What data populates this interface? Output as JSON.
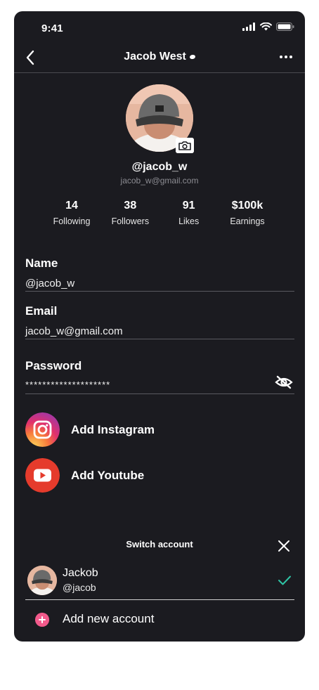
{
  "status": {
    "time": "9:41"
  },
  "nav": {
    "title": "Jacob West",
    "back_icon": "chevron-left-icon",
    "more_icon": "more-horizontal-icon"
  },
  "profile": {
    "handle": "@jacob_w",
    "email": "jacob_w@gmail.com",
    "camera_icon": "camera-icon"
  },
  "stats": [
    {
      "value": "14",
      "label": "Following"
    },
    {
      "value": "38",
      "label": "Followers"
    },
    {
      "value": "91",
      "label": "Likes"
    },
    {
      "value": "$100k",
      "label": "Earnings"
    }
  ],
  "fields": {
    "name": {
      "label": "Name",
      "value": "@jacob_w"
    },
    "email": {
      "label": "Email",
      "value": "jacob_w@gmail.com"
    },
    "password": {
      "label": "Password",
      "value": "********************",
      "toggle_icon": "eye-off-icon"
    }
  },
  "social": {
    "instagram": {
      "label": "Add Instagram",
      "icon": "instagram-icon",
      "color": "#e1306c"
    },
    "youtube": {
      "label": "Add Youtube",
      "icon": "youtube-icon",
      "color": "#e53b2c"
    }
  },
  "switch_account": {
    "title": "Switch account",
    "close_icon": "close-icon",
    "accounts": [
      {
        "name": "Jackob",
        "handle": "@jacob",
        "selected": true
      }
    ],
    "add_label": "Add new account",
    "accent": "#2ec4a5",
    "add_color": "#f25a8b"
  }
}
